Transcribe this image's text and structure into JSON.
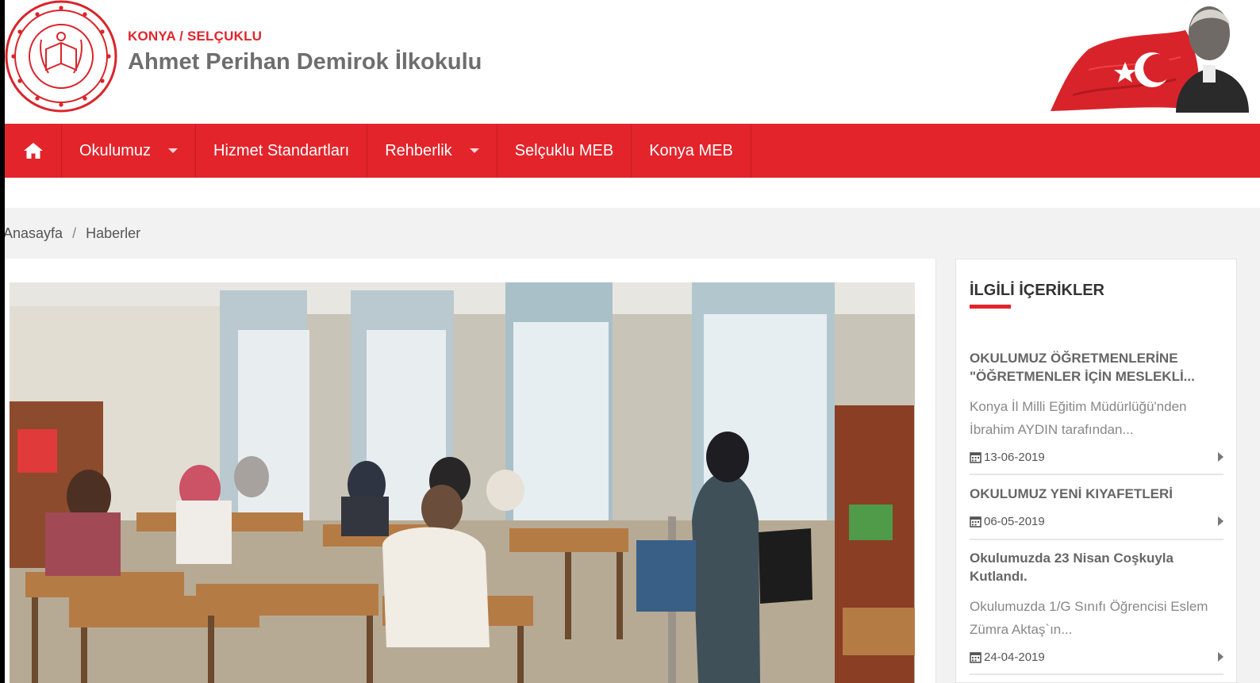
{
  "header": {
    "region": "KONYA / SELÇUKLU",
    "school_name": "Ahmet Perihan Demirok İlkokulu",
    "logo_icon": "meb-seal-icon",
    "flag_icon": "turkish-flag-ataturk-icon"
  },
  "nav": {
    "home_icon": "home-icon",
    "items": [
      {
        "label": "Okulumuz",
        "dropdown": true
      },
      {
        "label": "Hizmet Standartları",
        "dropdown": false
      },
      {
        "label": "Rehberlik",
        "dropdown": true
      },
      {
        "label": "Selçuklu MEB",
        "dropdown": false
      },
      {
        "label": "Konya MEB",
        "dropdown": false
      }
    ]
  },
  "breadcrumb": {
    "home": "Anasayfa",
    "separator": "/",
    "current": "Haberler"
  },
  "sidebar": {
    "title": "İLGİLİ İÇERİKLER",
    "news": [
      {
        "title": "OKULUMUZ ÖĞRETMENLERİNE \"ÖĞRETMENLER İÇİN MESLEKLİ...",
        "excerpt": "Konya İl Milli Eğitim Müdürlüğü'nden İbrahim AYDIN tarafından...",
        "date": "13-06-2019"
      },
      {
        "title": "OKULUMUZ YENİ KIYAFETLERİ",
        "excerpt": "",
        "date": "06-05-2019"
      },
      {
        "title": "Okulumuzda 23 Nisan Coşkuyla Kutlandı.",
        "excerpt": "Okulumuzda 1/G Sınıfı Öğrencisi Eslem Zümra Aktaş`ın...",
        "date": "24-04-2019"
      }
    ]
  },
  "colors": {
    "brand_red": "#e3242b",
    "title_gray": "#6e6e6e",
    "strip_gray": "#f2f2f2"
  }
}
